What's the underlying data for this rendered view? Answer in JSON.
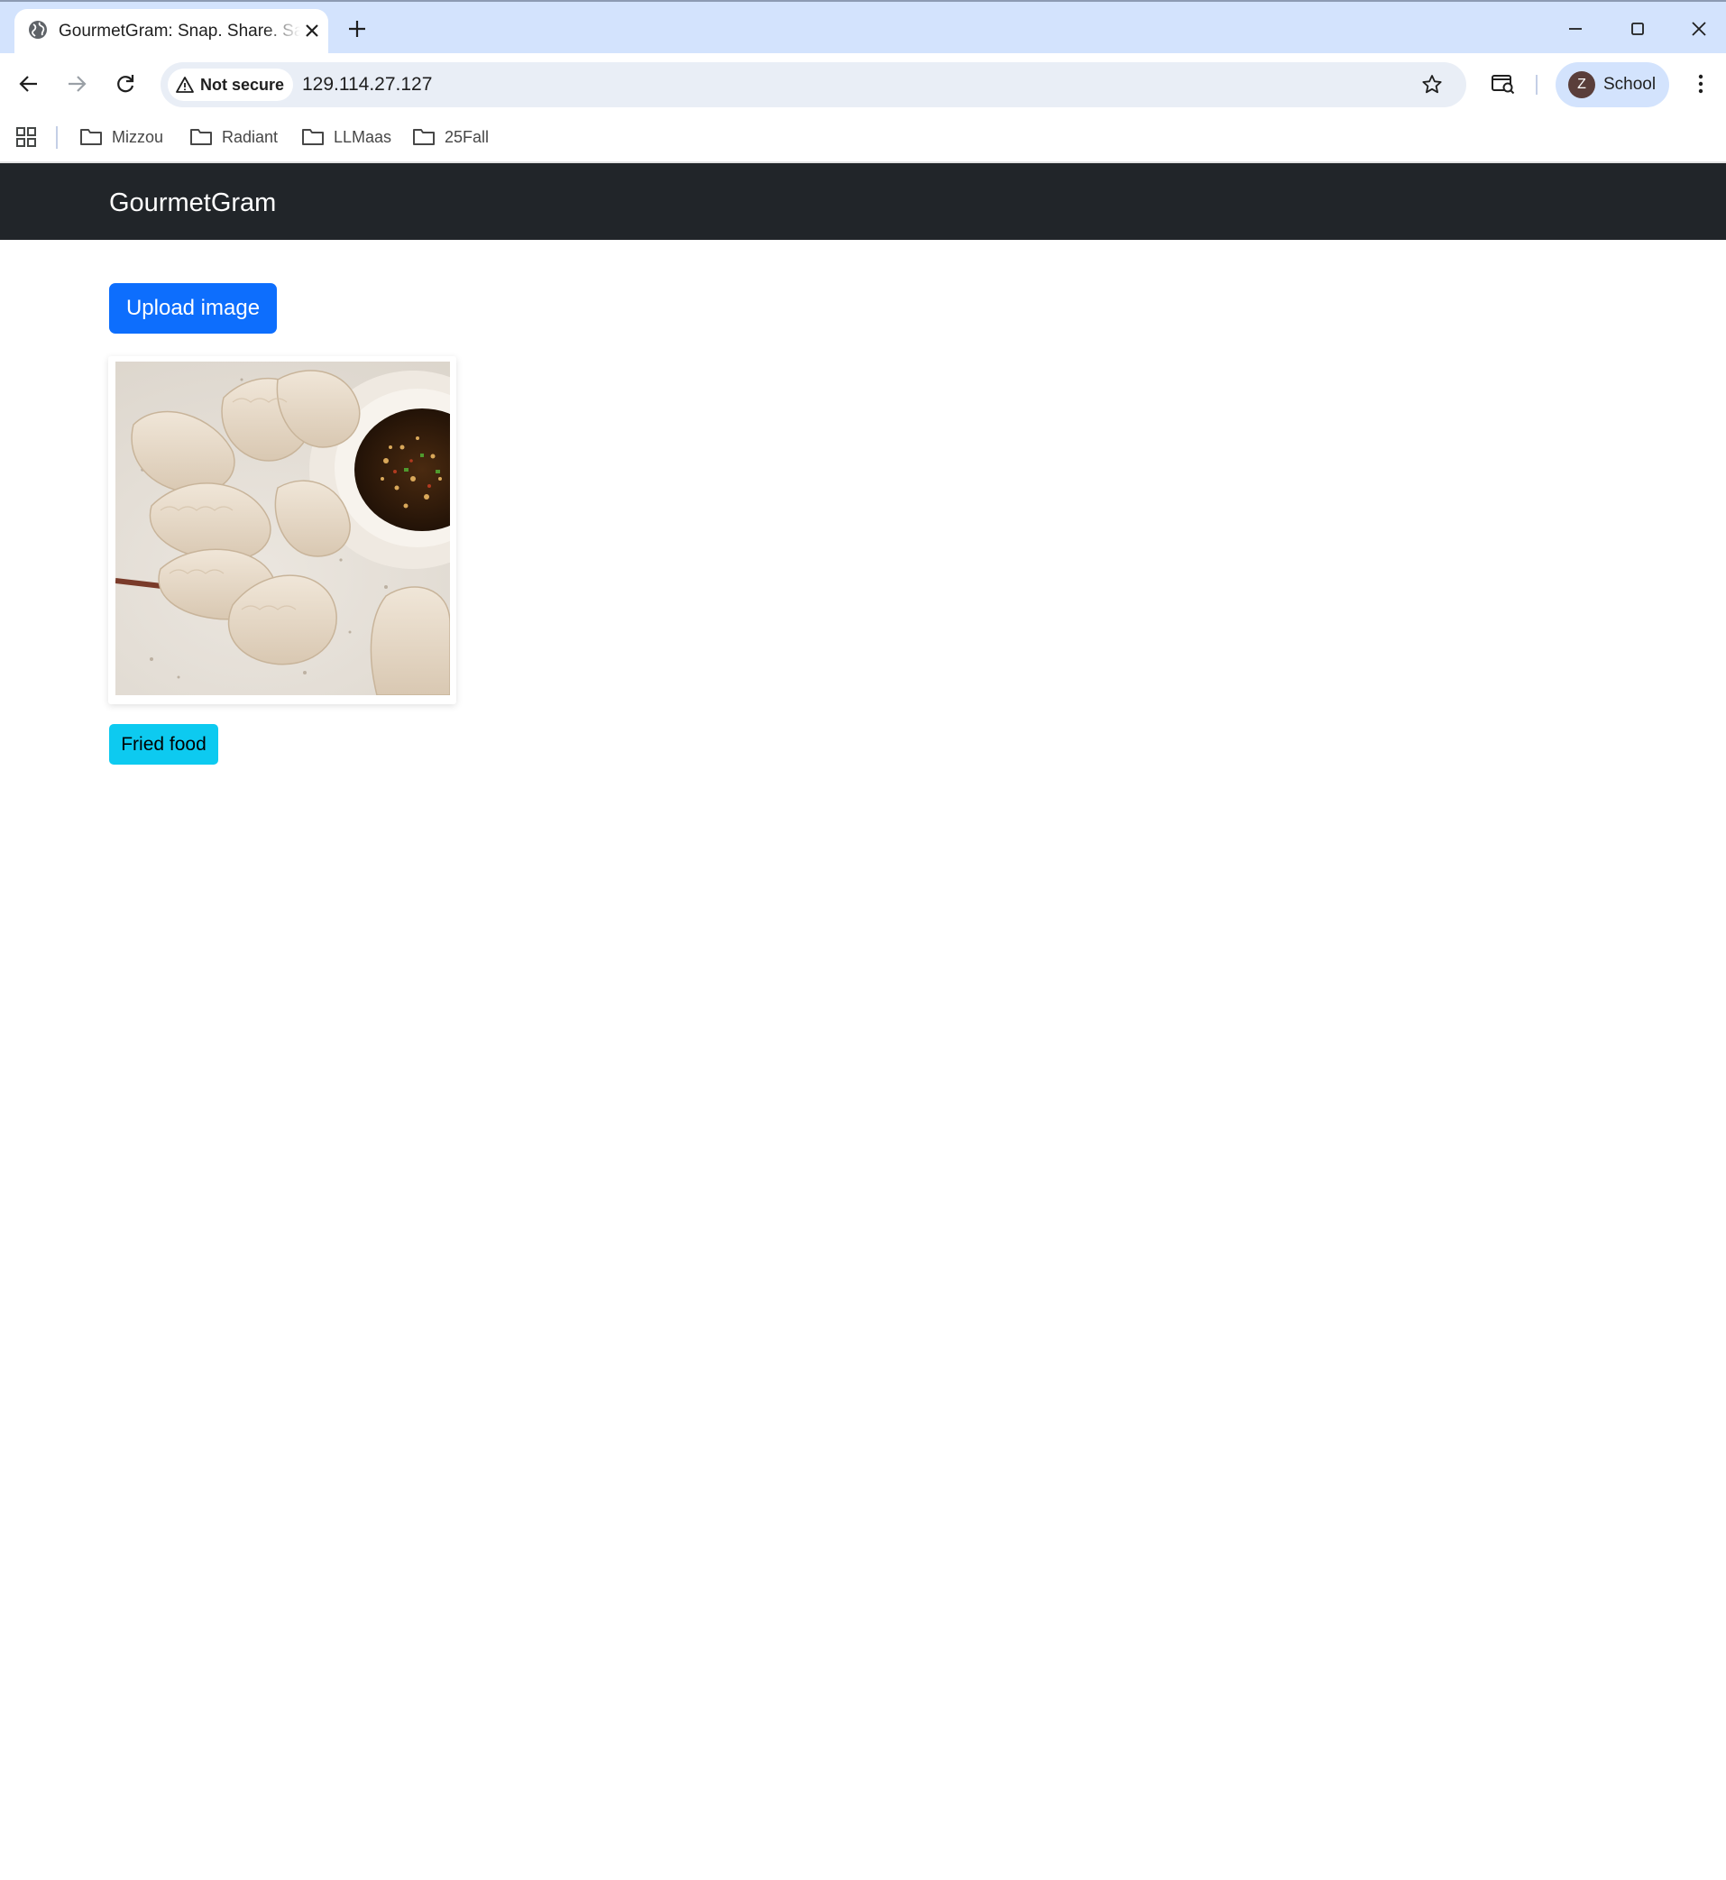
{
  "browser": {
    "tab_title": "GourmetGram: Snap. Share. Savor.",
    "security_label": "Not secure",
    "url": "129.114.27.127",
    "profile_initial": "Z",
    "profile_name": "School",
    "icons": [
      "globe-icon",
      "close-icon",
      "plus-icon",
      "minimize-icon",
      "maximize-icon",
      "window-close-icon",
      "back-icon",
      "forward-icon",
      "reload-icon",
      "warning-icon",
      "star-icon",
      "search-tabs-icon",
      "more-vert-icon",
      "apps-icon",
      "folder-icon"
    ]
  },
  "bookmarks": [
    {
      "label": "Mizzou"
    },
    {
      "label": "Radiant"
    },
    {
      "label": "LLMaas"
    },
    {
      "label": "25Fall"
    }
  ],
  "app": {
    "brand": "GourmetGram",
    "upload_label": "Upload image",
    "image_tag": "Fried food",
    "colors": {
      "navbar": "#212529",
      "primary": "#0d6efd",
      "badge": "#0dcaf0"
    }
  }
}
